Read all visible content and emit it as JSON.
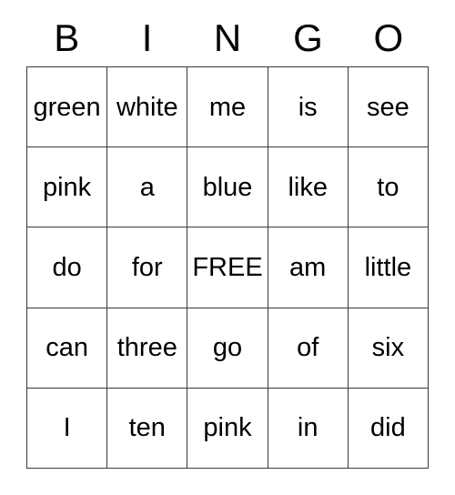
{
  "card": {
    "type": "bingo-card",
    "free_space_label": "FREE",
    "columns": 5,
    "rows": 5,
    "text_color": "#000000",
    "border_color": "#3a3a3a",
    "background_color": "#ffffff"
  },
  "header": {
    "letters": [
      "B",
      "I",
      "N",
      "G",
      "O"
    ]
  },
  "grid": {
    "rows": [
      [
        "green",
        "white",
        "me",
        "is",
        "see"
      ],
      [
        "pink",
        "a",
        "blue",
        "like",
        "to"
      ],
      [
        "do",
        "for",
        "FREE",
        "am",
        "little"
      ],
      [
        "can",
        "three",
        "go",
        "of",
        "six"
      ],
      [
        "I",
        "ten",
        "pink",
        "in",
        "did"
      ]
    ]
  }
}
